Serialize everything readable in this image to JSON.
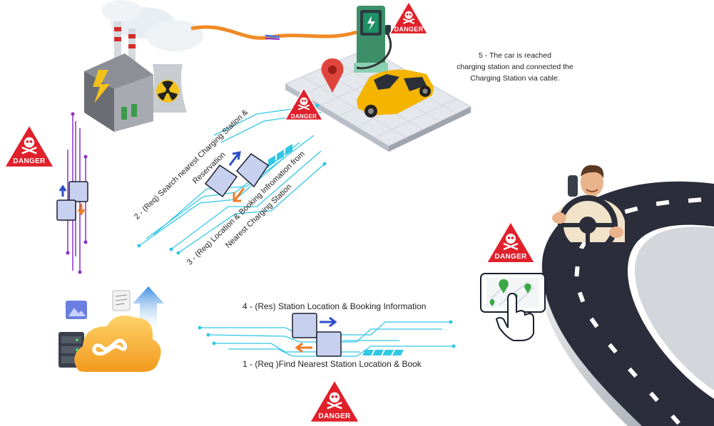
{
  "warnings": {
    "danger_label": "DANGER"
  },
  "steps": {
    "step1": "1 - (Req )Find Nearest Station Location & Book",
    "step2_line1": "2 - (Req) Search nearest Charging Station &",
    "step2_line2": "Reservation",
    "step3_line1": "3 - (Req) Location & Booking Infromation from",
    "step3_line2": "Nearest Charging Station",
    "step4": "4 - (Res) Station Location & Booking Information",
    "step5_line1": "5 - The car is reached",
    "step5_line2": "charging station and connected the",
    "step5_line3": "Charging Station via cable."
  },
  "colors": {
    "danger_red": "#e0202a",
    "circuit_cyan": "#33c7e6",
    "circuit_purple": "#8b2fc9",
    "car_yellow": "#f4b400",
    "road": "#2b2d3a",
    "cloud_orange": "#f7b23b"
  },
  "icons": [
    "power-plant-icon",
    "charging-station-icon",
    "car-icon",
    "map-pin-icon",
    "cloud-server-icon",
    "driver-icon",
    "phone-map-icon",
    "document-exchange-icon",
    "danger-sign-icon"
  ]
}
